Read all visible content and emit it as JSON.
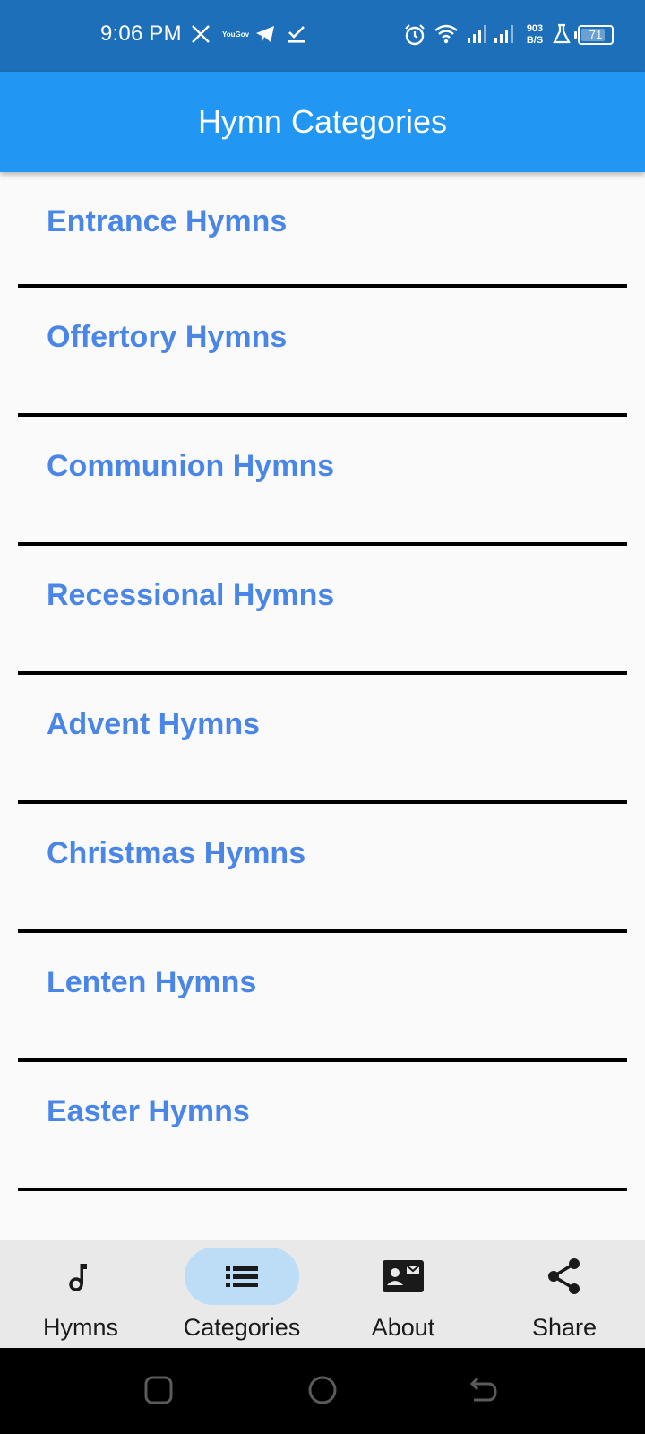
{
  "status_bar": {
    "time": "9:06 PM",
    "yougov_label": "YouGov",
    "net_speed_value": "903",
    "net_speed_unit": "B/S",
    "battery_level": "71",
    "icons": [
      "x-icon",
      "yougov-icon",
      "telegram-icon",
      "check-icon",
      "alarm-icon",
      "wifi-icon",
      "signal-icon",
      "signal-icon",
      "lab-icon",
      "battery-icon"
    ]
  },
  "app_bar": {
    "title": "Hymn Categories"
  },
  "categories": [
    {
      "label": "Entrance Hymns"
    },
    {
      "label": "Offertory Hymns"
    },
    {
      "label": "Communion Hymns"
    },
    {
      "label": "Recessional Hymns"
    },
    {
      "label": "Advent Hymns"
    },
    {
      "label": "Christmas Hymns"
    },
    {
      "label": "Lenten Hymns"
    },
    {
      "label": "Easter Hymns"
    }
  ],
  "bottom_nav": {
    "selected": "Categories",
    "items": [
      {
        "label": "Hymns",
        "icon": "music-note-icon"
      },
      {
        "label": "Categories",
        "icon": "list-icon"
      },
      {
        "label": "About",
        "icon": "contact-card-icon"
      },
      {
        "label": "Share",
        "icon": "share-icon"
      }
    ]
  },
  "colors": {
    "status_bar": "#1c6fb8",
    "app_bar": "#2196f3",
    "category_text": "#4a86e8",
    "divider": "#000000",
    "nav_background": "#e9e9e9",
    "nav_active_pill": "#bddcf5"
  }
}
